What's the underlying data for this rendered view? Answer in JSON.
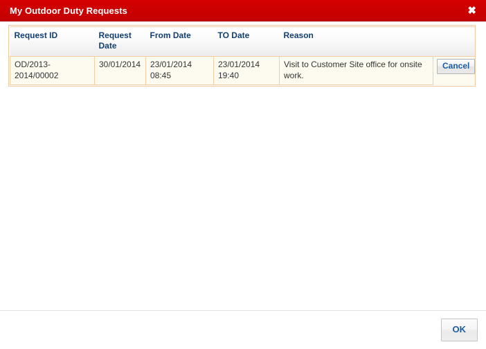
{
  "window": {
    "title": "My Outdoor Duty Requests",
    "close_icon": "close-icon",
    "close_glyph": "✖",
    "titlebar_color": "#CC0000",
    "title_text_color": "#FFFFFF"
  },
  "table": {
    "header_text_color": "#123F73",
    "border_color": "#F3CDA4",
    "row_background": "#FDFBF0",
    "columns": [
      "Request ID",
      "Request Date",
      "From Date",
      "TO Date",
      "Reason",
      ""
    ],
    "rows": [
      {
        "request_id": "OD/2013-2014/00002",
        "request_date": "30/01/2014",
        "from_date": "23/01/2014 08:45",
        "to_date": "23/01/2014 19:40",
        "reason": "Visit to Customer Site office for onsite work.",
        "action_label": "Cancel"
      }
    ]
  },
  "footer": {
    "ok_label": "OK",
    "button_text_color": "#1A5CA8"
  }
}
